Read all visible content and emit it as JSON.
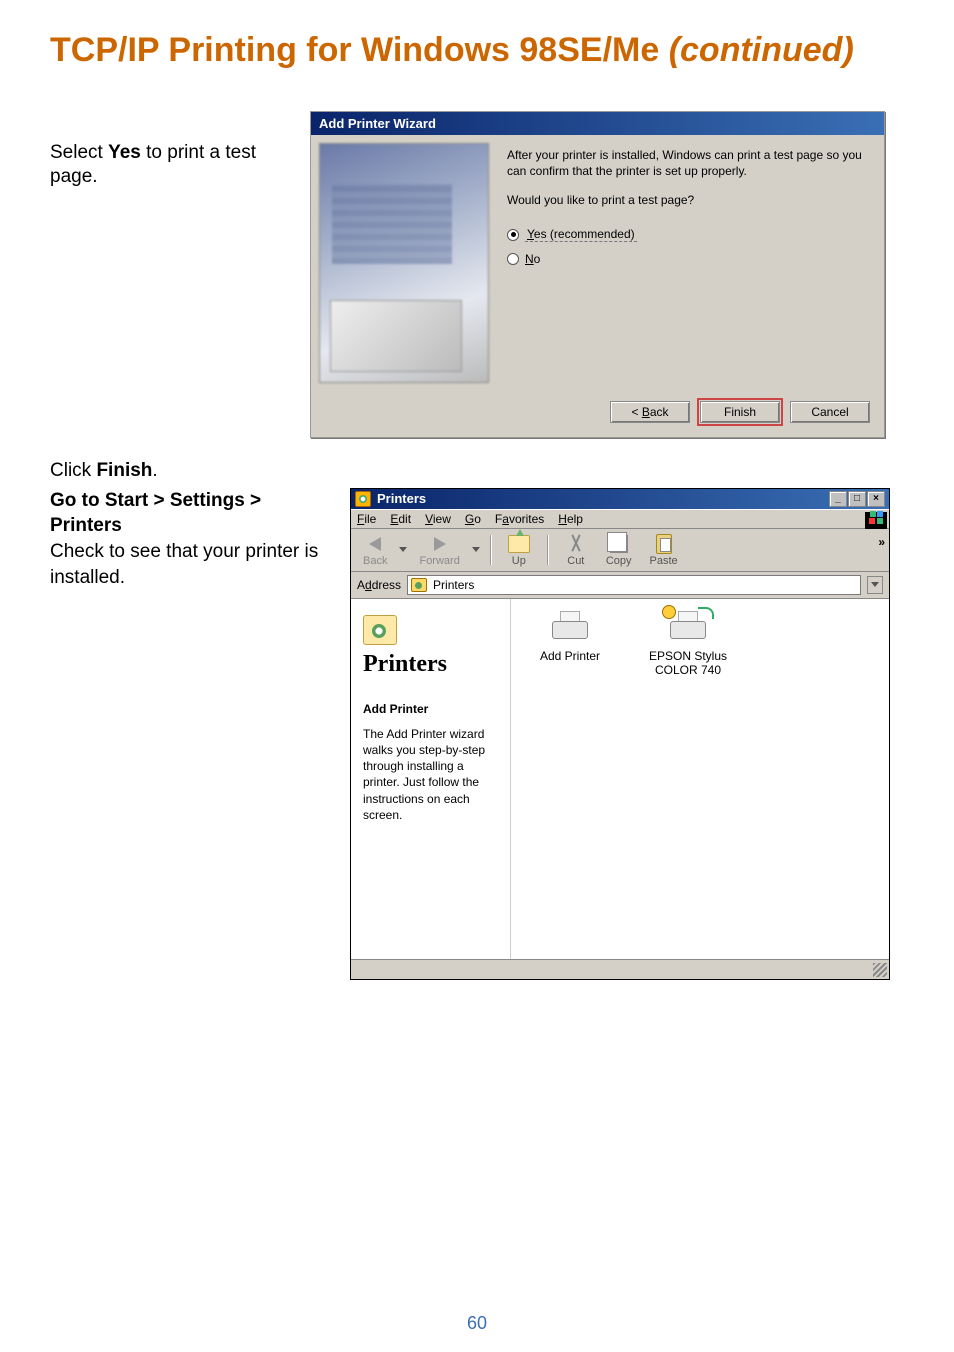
{
  "page": {
    "title_main": "TCP/IP Printing for Windows 98SE/Me ",
    "title_ital": "(continued)",
    "number": "60"
  },
  "instructions": {
    "line1a": "Select ",
    "line1b": "Yes",
    "line1c": " to print a test page.",
    "line2a": "Click ",
    "line2b": "Finish",
    "line2c": ".",
    "line3a": "Go to Start > Settings > Printers",
    "line3b": "Check to see that your printer is installed."
  },
  "wizard": {
    "title": "Add Printer Wizard",
    "msg": "After your printer is installed, Windows can print a test page so you can confirm that the printer is set up properly.",
    "question": "Would you like to print a test page?",
    "opt_yes_pre": "Y",
    "opt_yes_rest": "es (recommended)",
    "opt_no_pre": "N",
    "opt_no_rest": "o",
    "btn_back_pre": "< ",
    "btn_back_u": "B",
    "btn_back_rest": "ack",
    "btn_finish": "Finish",
    "btn_cancel": "Cancel"
  },
  "explorer": {
    "title": "Printers",
    "menu": {
      "file_u": "F",
      "file_r": "ile",
      "edit_u": "E",
      "edit_r": "dit",
      "view_u": "V",
      "view_r": "iew",
      "go_u": "G",
      "go_r": "o",
      "fav_pre": "F",
      "fav_u": "a",
      "fav_r": "vorites",
      "help_u": "H",
      "help_r": "elp"
    },
    "toolbar": {
      "back": "Back",
      "forward": "Forward",
      "up": "Up",
      "cut": "Cut",
      "copy": "Copy",
      "paste": "Paste"
    },
    "address_label_pre": "A",
    "address_label_u": "d",
    "address_label_r": "dress",
    "address_value": "Printers",
    "sidebar_title": "Printers",
    "sidebar_sub": "Add Printer",
    "sidebar_desc": "The Add Printer wizard walks you step-by-step through installing a printer. Just follow the instructions on each screen.",
    "items": {
      "add_printer": "Add Printer",
      "installed_name1": "EPSON Stylus",
      "installed_name2": "COLOR 740"
    }
  }
}
